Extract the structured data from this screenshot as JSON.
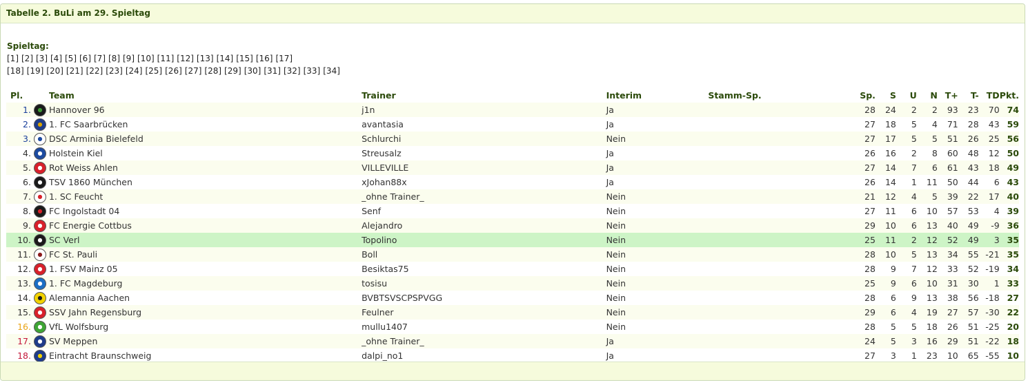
{
  "panel": {
    "title": "Tabelle 2. BuLi am 29. Spieltag"
  },
  "spieltag": {
    "label": "Spieltag:",
    "row1": [
      "[1]",
      "[2]",
      "[3]",
      "[4]",
      "[5]",
      "[6]",
      "[7]",
      "[8]",
      "[9]",
      "[10]",
      "[11]",
      "[12]",
      "[13]",
      "[14]",
      "[15]",
      "[16]",
      "[17]"
    ],
    "row2": [
      "[18]",
      "[19]",
      "[20]",
      "[21]",
      "[22]",
      "[23]",
      "[24]",
      "[25]",
      "[26]",
      "[27]",
      "[28]",
      "[29]",
      "[30]",
      "[31]",
      "[32]",
      "[33]",
      "[34]"
    ]
  },
  "table": {
    "headers": {
      "pl": "Pl.",
      "team": "Team",
      "trainer": "Trainer",
      "interim": "Interim",
      "stamm": "Stamm-Sp.",
      "sp": "Sp.",
      "s": "S",
      "u": "U",
      "n": "N",
      "tplus": "T+",
      "tminus": "T-",
      "td": "TD",
      "pkt": "Pkt."
    },
    "highlight_row": 10,
    "colors": {
      "promotion": "#1a3f9c",
      "relegation_playoff": "#e8a317",
      "relegation": "#c4173a",
      "default": "#333333",
      "highlight": "#cdf4c6"
    },
    "rows": [
      {
        "pl": "1.",
        "team": "Hannover 96",
        "trainer": "j1n",
        "interim": "Ja",
        "stamm": "",
        "sp": "28",
        "s": "24",
        "u": "2",
        "n": "2",
        "tplus": "93",
        "tminus": "23",
        "td": "70",
        "pkt": "74",
        "zone": "promotion",
        "logo": {
          "bg": "#1a1a1a",
          "fg": "#3d9b35",
          "icon": "hannover-96-logo-icon"
        }
      },
      {
        "pl": "2.",
        "team": "1. FC Saarbrücken",
        "trainer": "avantasia",
        "interim": "Ja",
        "stamm": "",
        "sp": "27",
        "s": "18",
        "u": "5",
        "n": "4",
        "tplus": "71",
        "tminus": "28",
        "td": "43",
        "pkt": "59",
        "zone": "promotion",
        "logo": {
          "bg": "#1f3c8a",
          "fg": "#d9a400",
          "icon": "saarbruecken-logo-icon"
        }
      },
      {
        "pl": "3.",
        "team": "DSC Arminia Bielefeld",
        "trainer": "Schlurchi",
        "interim": "Nein",
        "stamm": "",
        "sp": "27",
        "s": "17",
        "u": "5",
        "n": "5",
        "tplus": "51",
        "tminus": "26",
        "td": "25",
        "pkt": "56",
        "zone": "promotion",
        "logo": {
          "bg": "#ffffff",
          "fg": "#1c4aa0",
          "icon": "arminia-bielefeld-logo-icon"
        }
      },
      {
        "pl": "4.",
        "team": "Holstein Kiel",
        "trainer": "Streusalz",
        "interim": "Ja",
        "stamm": "",
        "sp": "26",
        "s": "16",
        "u": "2",
        "n": "8",
        "tplus": "60",
        "tminus": "48",
        "td": "12",
        "pkt": "50",
        "zone": "default",
        "logo": {
          "bg": "#1c4aa0",
          "fg": "#ffffff",
          "icon": "holstein-kiel-logo-icon"
        }
      },
      {
        "pl": "5.",
        "team": "Rot Weiss Ahlen",
        "trainer": "VILLEVILLE",
        "interim": "Ja",
        "stamm": "",
        "sp": "27",
        "s": "14",
        "u": "7",
        "n": "6",
        "tplus": "61",
        "tminus": "43",
        "td": "18",
        "pkt": "49",
        "zone": "default",
        "logo": {
          "bg": "#d8212a",
          "fg": "#ffffff",
          "icon": "rot-weiss-ahlen-logo-icon"
        }
      },
      {
        "pl": "6.",
        "team": "TSV 1860 München",
        "trainer": "xJohan88x",
        "interim": "Ja",
        "stamm": "",
        "sp": "26",
        "s": "14",
        "u": "1",
        "n": "11",
        "tplus": "50",
        "tminus": "44",
        "td": "6",
        "pkt": "43",
        "zone": "default",
        "logo": {
          "bg": "#1a1a1a",
          "fg": "#ffffff",
          "icon": "tsv-1860-logo-icon"
        }
      },
      {
        "pl": "7.",
        "team": "1. SC Feucht",
        "trainer": "_ohne Trainer_",
        "interim": "Nein",
        "stamm": "",
        "sp": "21",
        "s": "12",
        "u": "4",
        "n": "5",
        "tplus": "39",
        "tminus": "22",
        "td": "17",
        "pkt": "40",
        "zone": "default",
        "logo": {
          "bg": "#ffffff",
          "fg": "#d8212a",
          "icon": "sc-feucht-logo-icon"
        }
      },
      {
        "pl": "8.",
        "team": "FC Ingolstadt 04",
        "trainer": "Senf",
        "interim": "Nein",
        "stamm": "",
        "sp": "27",
        "s": "11",
        "u": "6",
        "n": "10",
        "tplus": "57",
        "tminus": "53",
        "td": "4",
        "pkt": "39",
        "zone": "default",
        "logo": {
          "bg": "#1a1a1a",
          "fg": "#d8212a",
          "icon": "fc-ingolstadt-logo-icon"
        }
      },
      {
        "pl": "9.",
        "team": "FC Energie Cottbus",
        "trainer": "Alejandro",
        "interim": "Nein",
        "stamm": "",
        "sp": "29",
        "s": "10",
        "u": "6",
        "n": "13",
        "tplus": "40",
        "tminus": "49",
        "td": "-9",
        "pkt": "36",
        "zone": "default",
        "logo": {
          "bg": "#d8212a",
          "fg": "#ffffff",
          "icon": "energie-cottbus-logo-icon"
        }
      },
      {
        "pl": "10.",
        "team": "SC Verl",
        "trainer": "Topolino",
        "interim": "Nein",
        "stamm": "",
        "sp": "25",
        "s": "11",
        "u": "2",
        "n": "12",
        "tplus": "52",
        "tminus": "49",
        "td": "3",
        "pkt": "35",
        "zone": "default",
        "logo": {
          "bg": "#1a1a1a",
          "fg": "#ffffff",
          "icon": "sc-verl-logo-icon"
        }
      },
      {
        "pl": "11.",
        "team": "FC St. Pauli",
        "trainer": "Boll",
        "interim": "Nein",
        "stamm": "",
        "sp": "28",
        "s": "10",
        "u": "5",
        "n": "13",
        "tplus": "34",
        "tminus": "55",
        "td": "-21",
        "pkt": "35",
        "zone": "default",
        "logo": {
          "bg": "#ffffff",
          "fg": "#8b1a1a",
          "icon": "st-pauli-logo-icon"
        }
      },
      {
        "pl": "12.",
        "team": "1. FSV Mainz 05",
        "trainer": "Besiktas75",
        "interim": "Nein",
        "stamm": "",
        "sp": "28",
        "s": "9",
        "u": "7",
        "n": "12",
        "tplus": "33",
        "tminus": "52",
        "td": "-19",
        "pkt": "34",
        "zone": "default",
        "logo": {
          "bg": "#d8212a",
          "fg": "#ffffff",
          "icon": "mainz-05-logo-icon"
        }
      },
      {
        "pl": "13.",
        "team": "1. FC Magdeburg",
        "trainer": "tosisu",
        "interim": "Nein",
        "stamm": "",
        "sp": "25",
        "s": "9",
        "u": "6",
        "n": "10",
        "tplus": "31",
        "tminus": "30",
        "td": "1",
        "pkt": "33",
        "zone": "default",
        "logo": {
          "bg": "#1c6fc4",
          "fg": "#ffffff",
          "icon": "fc-magdeburg-logo-icon"
        }
      },
      {
        "pl": "14.",
        "team": "Alemannia Aachen",
        "trainer": "BVBTSVSCPSPVGG",
        "interim": "Nein",
        "stamm": "",
        "sp": "28",
        "s": "6",
        "u": "9",
        "n": "13",
        "tplus": "38",
        "tminus": "56",
        "td": "-18",
        "pkt": "27",
        "zone": "default",
        "logo": {
          "bg": "#f2d200",
          "fg": "#1a1a1a",
          "icon": "alemannia-aachen-logo-icon"
        }
      },
      {
        "pl": "15.",
        "team": "SSV Jahn Regensburg",
        "trainer": "Feulner",
        "interim": "Nein",
        "stamm": "",
        "sp": "29",
        "s": "6",
        "u": "4",
        "n": "19",
        "tplus": "27",
        "tminus": "57",
        "td": "-30",
        "pkt": "22",
        "zone": "default",
        "logo": {
          "bg": "#d8212a",
          "fg": "#ffffff",
          "icon": "jahn-regensburg-logo-icon"
        }
      },
      {
        "pl": "16.",
        "team": "VfL Wolfsburg",
        "trainer": "mullu1407",
        "interim": "Nein",
        "stamm": "",
        "sp": "28",
        "s": "5",
        "u": "5",
        "n": "18",
        "tplus": "26",
        "tminus": "51",
        "td": "-25",
        "pkt": "20",
        "zone": "relegation_playoff",
        "logo": {
          "bg": "#3fa535",
          "fg": "#ffffff",
          "icon": "vfl-wolfsburg-logo-icon"
        }
      },
      {
        "pl": "17.",
        "team": "SV Meppen",
        "trainer": "_ohne Trainer_",
        "interim": "Ja",
        "stamm": "",
        "sp": "24",
        "s": "5",
        "u": "3",
        "n": "16",
        "tplus": "29",
        "tminus": "51",
        "td": "-22",
        "pkt": "18",
        "zone": "relegation",
        "logo": {
          "bg": "#1f3c8a",
          "fg": "#ffffff",
          "icon": "sv-meppen-logo-icon"
        }
      },
      {
        "pl": "18.",
        "team": "Eintracht Braunschweig",
        "trainer": "dalpi_no1",
        "interim": "Ja",
        "stamm": "",
        "sp": "27",
        "s": "3",
        "u": "1",
        "n": "23",
        "tplus": "10",
        "tminus": "65",
        "td": "-55",
        "pkt": "10",
        "zone": "relegation",
        "logo": {
          "bg": "#1f3c8a",
          "fg": "#f2d200",
          "icon": "eintracht-braunschweig-logo-icon"
        }
      }
    ]
  }
}
